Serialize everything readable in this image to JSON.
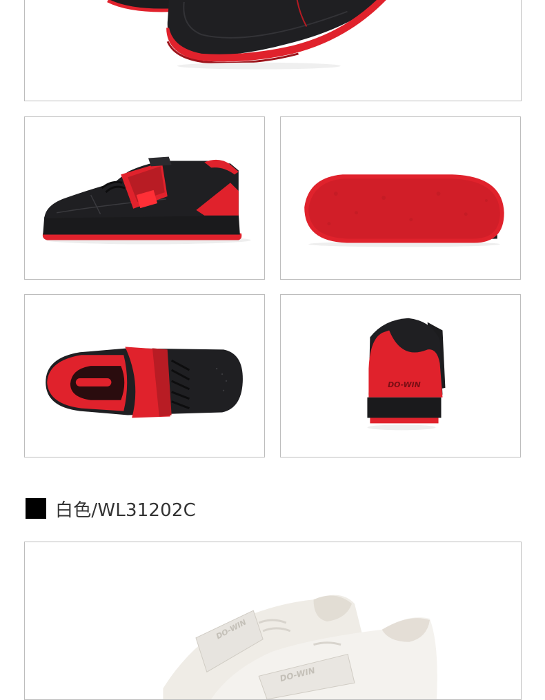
{
  "colors": {
    "shoe_black": "#1c1c1e",
    "shoe_red": "#e0222c",
    "frame_border": "#bdbdbd",
    "heading_text": "#333333",
    "white_shoe": "#f1efea"
  },
  "gallery": {
    "views": [
      {
        "name": "side-view"
      },
      {
        "name": "sole-view"
      },
      {
        "name": "top-view"
      },
      {
        "name": "heel-view"
      }
    ],
    "brand_text": "DO-WIN"
  },
  "section": {
    "title": "白色/WL31202C",
    "marker_color": "#000000"
  }
}
